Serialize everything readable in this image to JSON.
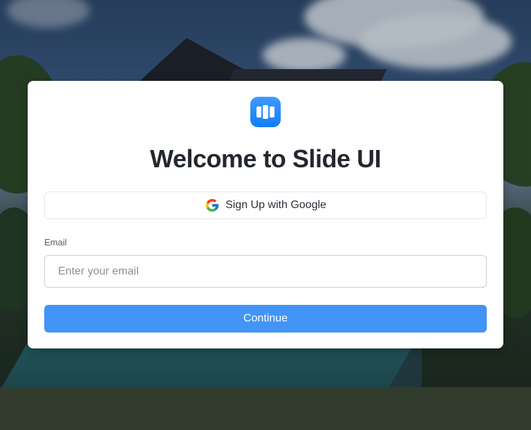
{
  "card": {
    "title": "Welcome to Slide UI",
    "google_button_label": "Sign Up with Google",
    "email_label": "Email",
    "email_placeholder": "Enter your email",
    "email_value": "",
    "continue_label": "Continue"
  },
  "icons": {
    "logo": "slide-ui-logo-icon",
    "google": "google-g-icon"
  },
  "colors": {
    "primary": "#4294f7",
    "logo": "#137df6",
    "title": "#23272e"
  }
}
